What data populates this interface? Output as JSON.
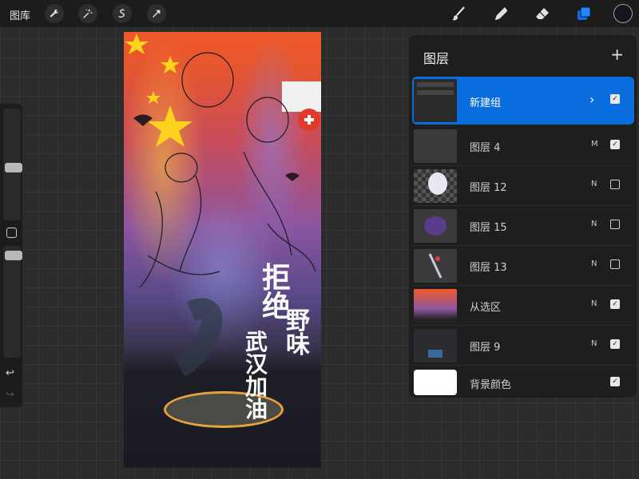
{
  "topbar": {
    "gallery_label": "图库",
    "left_tools": [
      {
        "name": "wrench-icon"
      },
      {
        "name": "magic-wand-icon"
      },
      {
        "name": "selection-icon"
      },
      {
        "name": "transform-arrow-icon"
      }
    ],
    "right_tools": [
      {
        "name": "brush-icon"
      },
      {
        "name": "smudge-icon"
      },
      {
        "name": "eraser-icon"
      },
      {
        "name": "layers-icon"
      }
    ],
    "active_tool": "layers-icon",
    "accent_color": "#0a6ddd",
    "current_color": "#14141e"
  },
  "sidebar": {
    "brush_size_level": 0.55,
    "opacity_level": 0.9,
    "undo_label": "↩",
    "redo_label": "↪"
  },
  "canvas": {
    "calligraphy_1": "拒绝",
    "calligraphy_2": "野味",
    "calligraphy_3": "武汉加油"
  },
  "layers_panel": {
    "title": "图层",
    "add_label": "+",
    "layers": [
      {
        "name": "新建组",
        "mode": "",
        "group": true,
        "visible": true,
        "selected": true
      },
      {
        "name": "图层 4",
        "mode": "M",
        "visible": true
      },
      {
        "name": "图层 12",
        "mode": "N",
        "visible": false
      },
      {
        "name": "图层 15",
        "mode": "N",
        "visible": false
      },
      {
        "name": "图层 13",
        "mode": "N",
        "visible": false
      },
      {
        "name": "从选区",
        "mode": "N",
        "visible": true
      },
      {
        "name": "图层 9",
        "mode": "N",
        "visible": true
      },
      {
        "name": "背景颜色",
        "mode": "",
        "visible": true
      }
    ]
  }
}
